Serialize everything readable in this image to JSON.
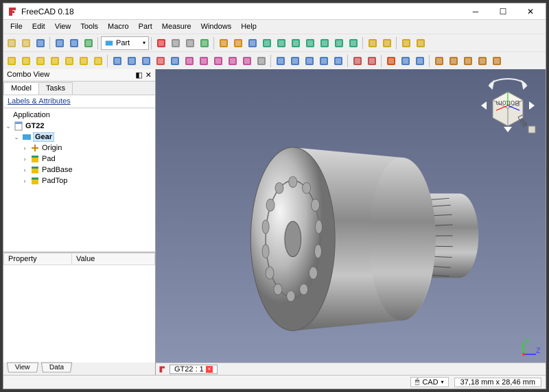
{
  "app": {
    "title": "FreeCAD 0.18"
  },
  "menu": [
    "File",
    "Edit",
    "View",
    "Tools",
    "Macro",
    "Part",
    "Measure",
    "Windows",
    "Help"
  ],
  "workbench": {
    "selected": "Part"
  },
  "combo": {
    "title": "Combo View",
    "tabs": [
      "Model",
      "Tasks"
    ],
    "activeTab": 0,
    "attrLabel": "Labels & Attributes",
    "tree": {
      "root": "Application",
      "doc": "GT22",
      "body": "Gear",
      "items": [
        "Origin",
        "Pad",
        "PadBase",
        "PadTop"
      ]
    },
    "props": {
      "headers": [
        "Property",
        "Value"
      ]
    },
    "bottomTabs": [
      "View",
      "Data"
    ]
  },
  "viewport": {
    "documentTab": "GT22 : 1",
    "navFace": "Bottom",
    "navSide": "Left"
  },
  "status": {
    "navMode": "CAD",
    "dimensions": "37,18 mm x 28,46 mm"
  },
  "toolbar1": [
    {
      "n": "new-doc",
      "c": "#d0b040"
    },
    {
      "n": "open-doc",
      "c": "#d0b040"
    },
    {
      "n": "save-doc",
      "c": "#3a70c0"
    },
    {
      "sep": true
    },
    {
      "n": "undo",
      "c": "#3a70c0"
    },
    {
      "n": "redo",
      "c": "#3a70c0"
    },
    {
      "n": "refresh",
      "c": "#3aa050"
    },
    {
      "sep": true
    },
    {
      "wb": true
    },
    {
      "sep": true
    },
    {
      "n": "macro-record",
      "c": "#d22"
    },
    {
      "n": "macro-stop",
      "c": "#888"
    },
    {
      "n": "macro-list",
      "c": "#888"
    },
    {
      "n": "macro-play",
      "c": "#3aa050"
    },
    {
      "sep": true
    },
    {
      "n": "fit-all",
      "c": "#d08000"
    },
    {
      "n": "fit-sel",
      "c": "#d08000"
    },
    {
      "n": "draw-style",
      "c": "#3a70c0"
    },
    {
      "n": "iso-view",
      "c": "#1aa070"
    },
    {
      "n": "front-view",
      "c": "#1aa070"
    },
    {
      "n": "top-view",
      "c": "#1aa070"
    },
    {
      "n": "right-view",
      "c": "#1aa070"
    },
    {
      "n": "rear-view",
      "c": "#1aa070"
    },
    {
      "n": "bottom-view",
      "c": "#1aa070"
    },
    {
      "n": "left-view",
      "c": "#1aa070"
    },
    {
      "sep": true
    },
    {
      "n": "measure-linear",
      "c": "#d0a000"
    },
    {
      "n": "measure-angle",
      "c": "#d0a000"
    },
    {
      "sep": true
    },
    {
      "n": "whats-this",
      "c": "#d0a000"
    },
    {
      "n": "appearance",
      "c": "#d0a000"
    }
  ],
  "toolbar2": [
    {
      "n": "part-box",
      "c": "#d9b000"
    },
    {
      "n": "part-cylinder",
      "c": "#d9b000"
    },
    {
      "n": "part-sphere",
      "c": "#d9b000"
    },
    {
      "n": "part-cone",
      "c": "#d9b000"
    },
    {
      "n": "part-torus",
      "c": "#d9b000"
    },
    {
      "n": "part-primitives",
      "c": "#d9b000"
    },
    {
      "n": "part-builder",
      "c": "#d9b000"
    },
    {
      "sep": true
    },
    {
      "n": "extrude",
      "c": "#3a70c0"
    },
    {
      "n": "revolve",
      "c": "#3a70c0"
    },
    {
      "n": "mirror",
      "c": "#3a70c0"
    },
    {
      "n": "fillet",
      "c": "#d04040"
    },
    {
      "n": "chamfer",
      "c": "#3a70c0"
    },
    {
      "n": "ruled",
      "c": "#c04090"
    },
    {
      "n": "loft",
      "c": "#c04090"
    },
    {
      "n": "sweep",
      "c": "#c04090"
    },
    {
      "n": "offset3d",
      "c": "#c04090"
    },
    {
      "n": "thickness",
      "c": "#c04090"
    },
    {
      "n": "compound",
      "c": "#888"
    },
    {
      "sep": true
    },
    {
      "n": "boolean",
      "c": "#3a70c0"
    },
    {
      "n": "cut",
      "c": "#3a70c0"
    },
    {
      "n": "union",
      "c": "#3a70c0"
    },
    {
      "n": "intersect",
      "c": "#3a70c0"
    },
    {
      "n": "join",
      "c": "#3a70c0"
    },
    {
      "sep": true
    },
    {
      "n": "split",
      "c": "#c04040"
    },
    {
      "n": "slice",
      "c": "#c04040"
    },
    {
      "sep": true
    },
    {
      "n": "check",
      "c": "#d04000"
    },
    {
      "n": "section",
      "c": "#3a70c0"
    },
    {
      "n": "cross",
      "c": "#3a70c0"
    },
    {
      "sep": true
    },
    {
      "n": "make-face",
      "c": "#b86f10"
    },
    {
      "n": "make-solid",
      "c": "#b86f10"
    },
    {
      "n": "reverse",
      "c": "#b86f10"
    },
    {
      "n": "color-face",
      "c": "#b86f10"
    },
    {
      "n": "convert",
      "c": "#b86f10"
    }
  ]
}
